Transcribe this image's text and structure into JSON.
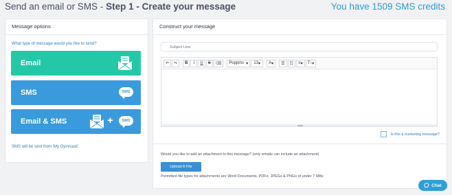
{
  "header": {
    "title_prefix": "Send an email or SMS - ",
    "title_step": "Step 1 - Create your message",
    "credits": "You have 1509 SMS credits"
  },
  "left_panel": {
    "title": "Message options",
    "question": "What type of message would you like to send?",
    "options": [
      {
        "label": "Email",
        "icon": "envelope-icon",
        "color": "#23c9a6"
      },
      {
        "label": "SMS",
        "icon": "sms-bubble-icon",
        "color": "#3a9bdc"
      },
      {
        "label": "Email & SMS",
        "icon": "envelope-plus-sms-icon",
        "color": "#3a9bdc"
      }
    ],
    "sms_icon_text": "SMS",
    "plus": "+",
    "sender_note": "SMS will be sent from 'My Gymnasti'"
  },
  "right_panel": {
    "title": "Construct your message",
    "subject_placeholder": "Subject Line",
    "toolbar": {
      "undo": "↶",
      "redo": "↷",
      "bold": "B",
      "italic": "I",
      "underline": "U",
      "strike": "S",
      "clear": "⌫",
      "font": "Poppins",
      "size": "13",
      "color": "A",
      "ul": "☰",
      "ol": "☷",
      "align": "≡",
      "height": "T↕"
    },
    "marketing_label": "Is this a marketing message?",
    "attachment_question": "Would you like to add an attachment to this message? (only emails can include an attachment)",
    "upload_label": "Upload A File",
    "permitted_text": "Permitted file types for attachments are Word Documents, PDFs, JPEGs & PNGs of under 7 MBs"
  },
  "chat": {
    "label": "Chat"
  }
}
